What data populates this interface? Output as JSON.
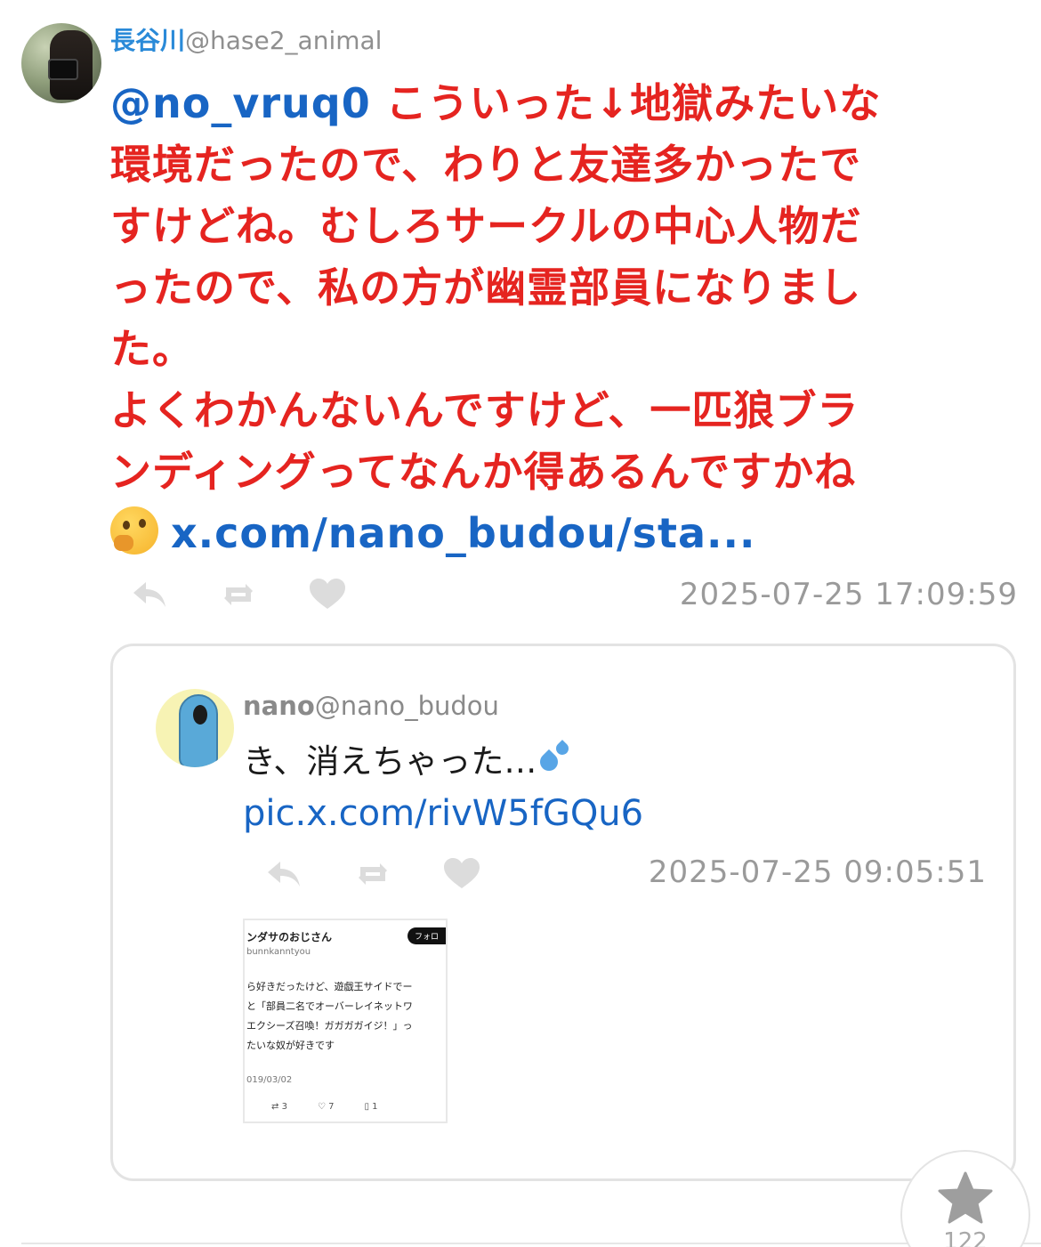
{
  "main_tweet": {
    "display_name": "長谷川",
    "handle": "@hase2_animal",
    "mention": "@no_vruq0",
    "lines": [
      "こういった↓地獄みたいな",
      "環境だったので、わりと友達多かったで",
      "すけどね。むしろサークルの中心人物だ",
      "ったので、私の方が幽霊部員になりまし",
      "た。",
      "よくわかんないんですけど、一匹狼ブラ",
      "ンディングってなんか得あるんですかね"
    ],
    "emoji": "thinking-face",
    "link": "x.com/nano_budou/sta...",
    "timestamp": "2025-07-25 17:09:59"
  },
  "quoted_tweet": {
    "display_name": "nano",
    "handle": "@nano_budou",
    "text": "き、消えちゃった…",
    "emoji": "sweat-droplets",
    "link": "pic.x.com/rivW5fGQu6",
    "timestamp": "2025-07-25 09:05:51",
    "image": {
      "name": "ンダサのおじさん",
      "handle": "bunnkanntyou",
      "follow": "フォロ",
      "lines": [
        "ら好きだったけど、遊戯王サイドでー",
        "と「部員二名でオーバーレイネットワ",
        "エクシーズ召喚！ガガガガイジ！」っ",
        "たいな奴が好きです"
      ],
      "date": "019/03/02",
      "retweets": "3",
      "likes": "7",
      "bookmarks": "1"
    }
  },
  "favorite": {
    "count": "122"
  },
  "colors": {
    "accent_blue": "#1865c4",
    "name_blue": "#2a8ad8",
    "body_red": "#e52420",
    "gray": "#9a9a9a"
  }
}
